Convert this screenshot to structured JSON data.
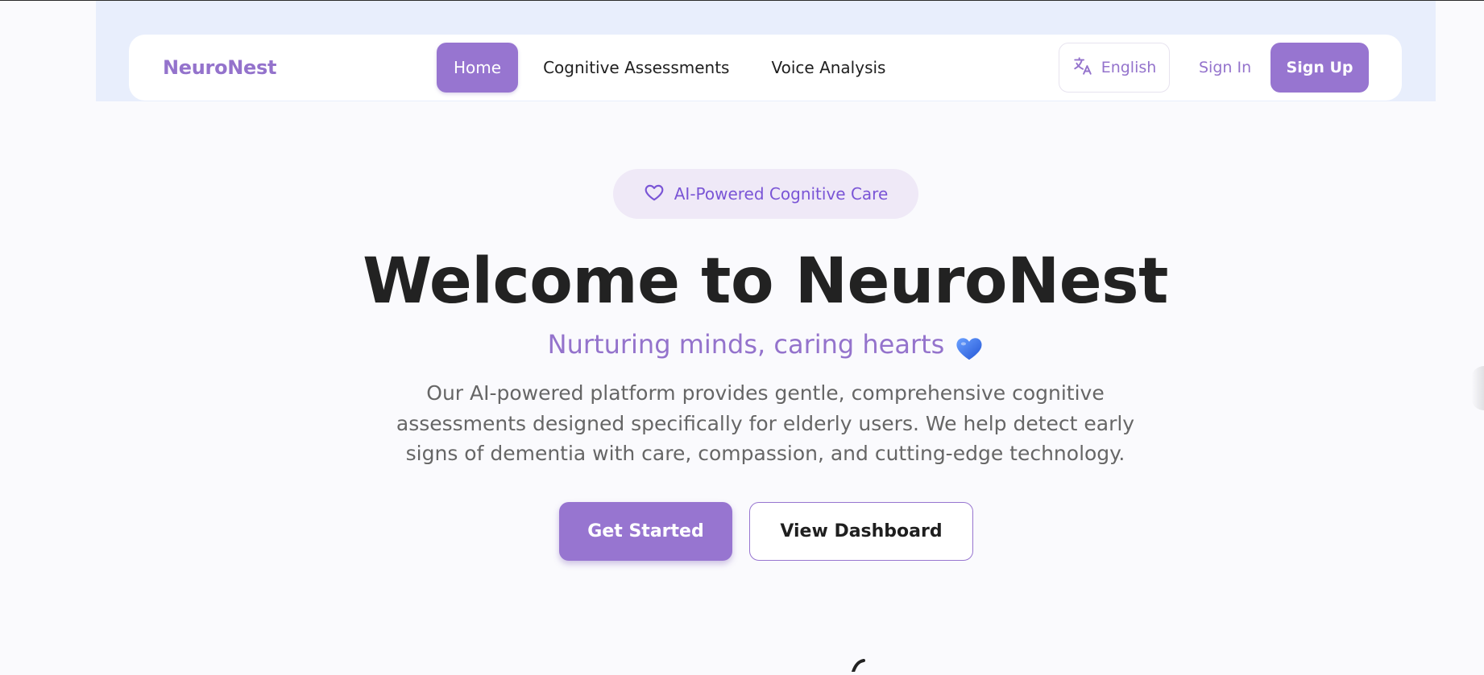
{
  "nav": {
    "brand": "NeuroNest",
    "links": [
      {
        "label": "Home",
        "active": true
      },
      {
        "label": "Cognitive Assessments",
        "active": false
      },
      {
        "label": "Voice Analysis",
        "active": false
      }
    ],
    "language": {
      "label": "English",
      "icon": "translate-icon"
    },
    "sign_in": "Sign In",
    "sign_up": "Sign Up"
  },
  "hero": {
    "badge": {
      "label": "AI-Powered Cognitive Care",
      "icon": "heart-outline-icon"
    },
    "title": "Welcome to NeuroNest",
    "subtitle": "Nurturing minds, caring hearts",
    "subtitle_icon": "blue-heart-emoji",
    "description": "Our AI-powered platform provides gentle, comprehensive cognitive assessments designed specifically for elderly users. We help detect early signs of dementia with care, compassion, and cutting-edge technology.",
    "primary_cta": "Get Started",
    "secondary_cta": "View Dashboard"
  },
  "colors": {
    "accent": "#9775d0",
    "brand_text": "#9473cc",
    "badge_bg": "#efe9f7",
    "badge_text": "#7a55d6",
    "header_band": "#e8eefc",
    "page_bg": "#fafafd",
    "heart_emoji": "#3b6fe0"
  }
}
